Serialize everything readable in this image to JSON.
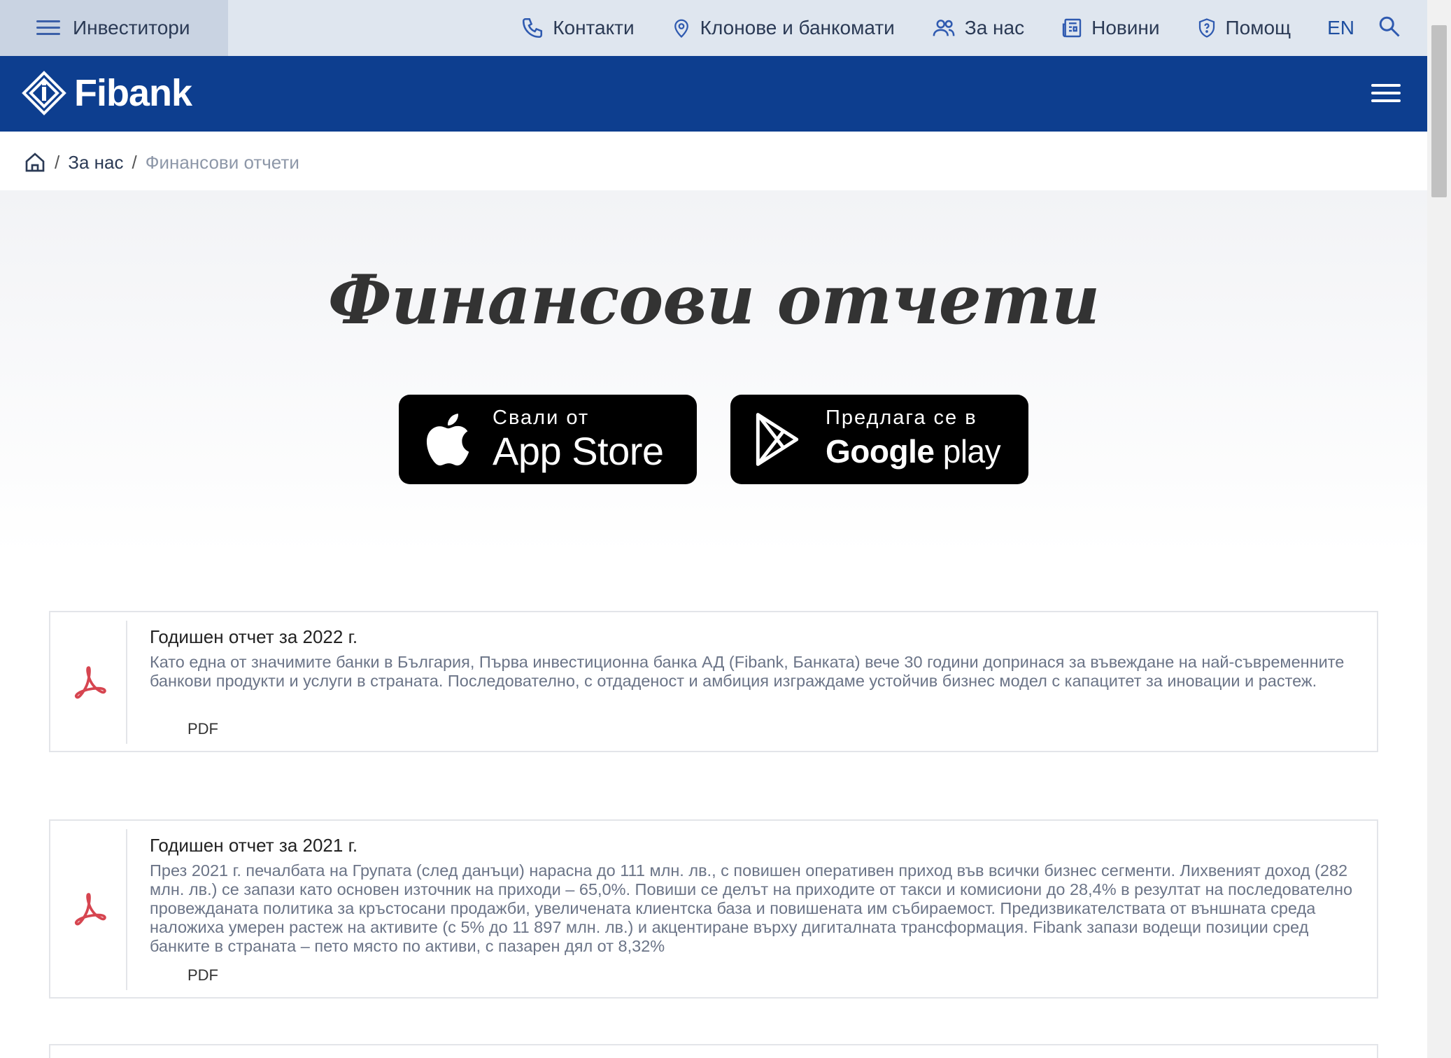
{
  "topbar": {
    "investors_label": "Инвеститори",
    "nav": [
      {
        "label": "Контакти",
        "icon": "phone-icon"
      },
      {
        "label": "Клонове и банкомати",
        "icon": "location-pin-icon"
      },
      {
        "label": "За нас",
        "icon": "users-icon"
      },
      {
        "label": "Новини",
        "icon": "newspaper-icon"
      },
      {
        "label": "Помощ",
        "icon": "help-shield-icon"
      }
    ],
    "language": "EN"
  },
  "header": {
    "logo_text": "Fibank",
    "brand_color": "#0d3e8f"
  },
  "breadcrumb": {
    "level1": "За нас",
    "current": "Финансови отчети"
  },
  "hero": {
    "title": "Финансови отчети",
    "app_store": {
      "small": "Свали от",
      "big": "App Store"
    },
    "google_play": {
      "small": "Предлага се в",
      "big_google": "Google",
      "big_play": "play"
    }
  },
  "reports": [
    {
      "title": "Годишен отчет за 2022 г.",
      "description": "Като една от значимите банки в България, Първа инвестиционна банка АД (Fibank, Банката) вече 30 години допринася за въвеждане на най-съвременните банкови продукти и услуги в страната. Последователно, с отдаденост и амбиция изграждаме устойчив бизнес модел с капацитет за иновации и растеж.",
      "format": "PDF"
    },
    {
      "title": "Годишен отчет за 2021 г.",
      "description": "През 2021 г. печалбата на Групата (след данъци) нарасна до 111 млн. лв., с повишен оперативен приход във всички бизнес сегменти. Лихвеният доход (282 млн. лв.) се запази като основен източник на приходи – 65,0%. Повиши се делът на приходите от такси и комисиони до 28,4% в резултат на последователно провежданата политика за кръстосани продажби, увеличената клиентска база и повишената им събираемост. Предизвикателствата от външната среда наложиха умерен растеж на активите (с 5% до 11 897 млн. лв.) и акцентиране върху дигиталната трансформация. Fibank запази водещи позиции сред банките в страната – пето място по активи, с пазарен дял от 8,32%",
      "format": "PDF"
    }
  ]
}
